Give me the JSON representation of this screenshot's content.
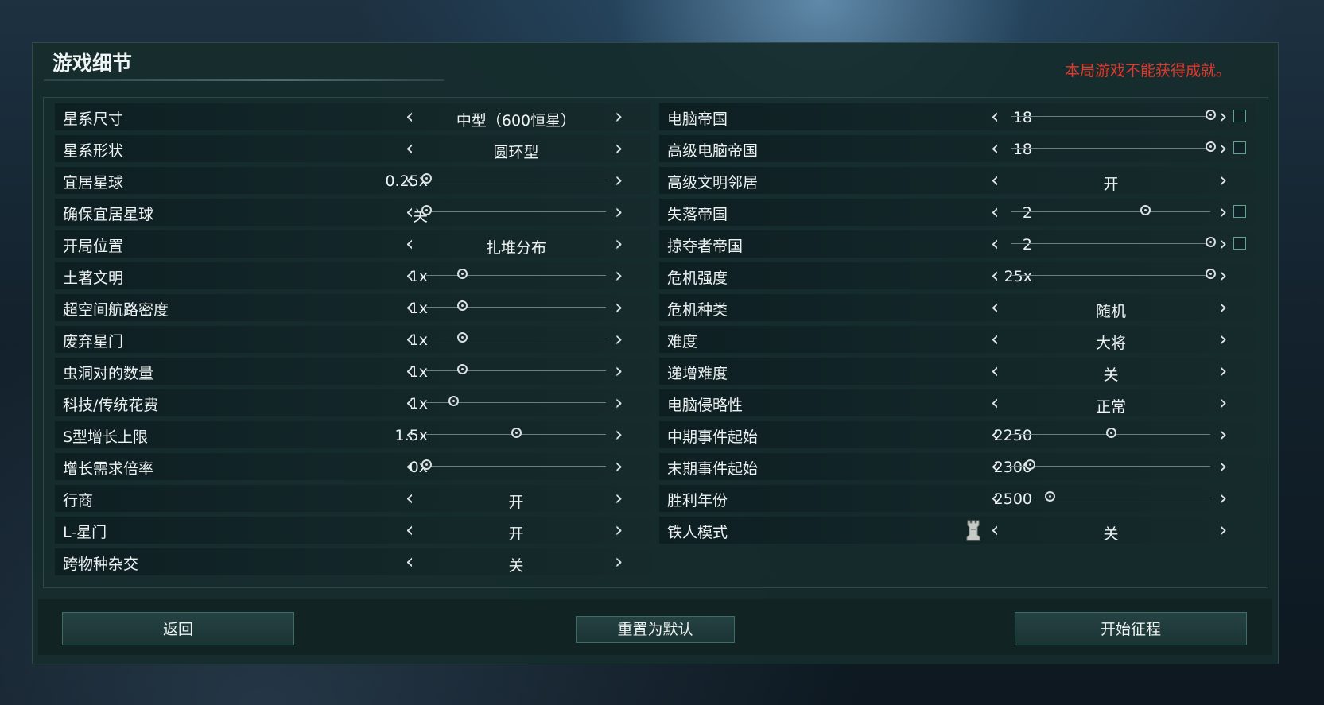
{
  "title": "游戏细节",
  "warning": "本局游戏不能获得成就。",
  "left_rows": [
    {
      "label": "星系尺寸",
      "type": "choice",
      "value": "中型（600恒星）"
    },
    {
      "label": "星系形状",
      "type": "choice",
      "value": "圆环型"
    },
    {
      "label": "宜居星球",
      "type": "slider",
      "value": "0.25x",
      "level": 0.0
    },
    {
      "label": "确保宜居星球",
      "type": "slider",
      "value": "关",
      "level": 0.0
    },
    {
      "label": "开局位置",
      "type": "choice",
      "value": "扎堆分布"
    },
    {
      "label": "土著文明",
      "type": "slider",
      "value": "1x",
      "level": 0.2
    },
    {
      "label": "超空间航路密度",
      "type": "slider",
      "value": "1x",
      "level": 0.2
    },
    {
      "label": "废弃星门",
      "type": "slider",
      "value": "1x",
      "level": 0.2
    },
    {
      "label": "虫洞对的数量",
      "type": "slider",
      "value": "1x",
      "level": 0.2
    },
    {
      "label": "科技/传统花费",
      "type": "slider",
      "value": "1x",
      "level": 0.15
    },
    {
      "label": "S型增长上限",
      "type": "slider",
      "value": "1.5x",
      "level": 0.5
    },
    {
      "label": "增长需求倍率",
      "type": "slider",
      "value": "0x",
      "level": 0.0
    },
    {
      "label": "行商",
      "type": "choice",
      "value": "开"
    },
    {
      "label": "L-星门",
      "type": "choice",
      "value": "开"
    },
    {
      "label": "跨物种杂交",
      "type": "choice",
      "value": "关"
    }
  ],
  "right_rows": [
    {
      "label": "电脑帝国",
      "type": "slider",
      "value": "18",
      "level": 1.0,
      "checkbox": true
    },
    {
      "label": "高级电脑帝国",
      "type": "slider",
      "value": "18",
      "level": 1.0,
      "checkbox": true
    },
    {
      "label": "高级文明邻居",
      "type": "choice",
      "value": "开"
    },
    {
      "label": "失落帝国",
      "type": "slider",
      "value": "2",
      "level": 0.67,
      "checkbox": true
    },
    {
      "label": "掠夺者帝国",
      "type": "slider",
      "value": "2",
      "level": 1.0,
      "checkbox": true
    },
    {
      "label": "危机强度",
      "type": "slider",
      "value": "25x",
      "level": 1.0
    },
    {
      "label": "危机种类",
      "type": "choice",
      "value": "随机"
    },
    {
      "label": "难度",
      "type": "choice",
      "value": "大将"
    },
    {
      "label": "递增难度",
      "type": "choice",
      "value": "关"
    },
    {
      "label": "电脑侵略性",
      "type": "choice",
      "value": "正常"
    },
    {
      "label": "中期事件起始",
      "type": "slider",
      "value": "2250",
      "level": 0.5
    },
    {
      "label": "末期事件起始",
      "type": "slider",
      "value": "2300",
      "level": 0.09
    },
    {
      "label": "胜利年份",
      "type": "slider",
      "value": "2500",
      "level": 0.19
    },
    {
      "label": "铁人模式",
      "type": "choice",
      "value": "关",
      "icon": "ironman-rook-icon"
    }
  ],
  "buttons": {
    "back": "返回",
    "reset": "重置为默认",
    "start": "开始征程"
  },
  "icons": {
    "left_arrow": "chevron-left-icon",
    "right_arrow": "chevron-right-icon"
  },
  "colors": {
    "warning": "#e0392d",
    "checkbox_border": "#5fa58b"
  }
}
